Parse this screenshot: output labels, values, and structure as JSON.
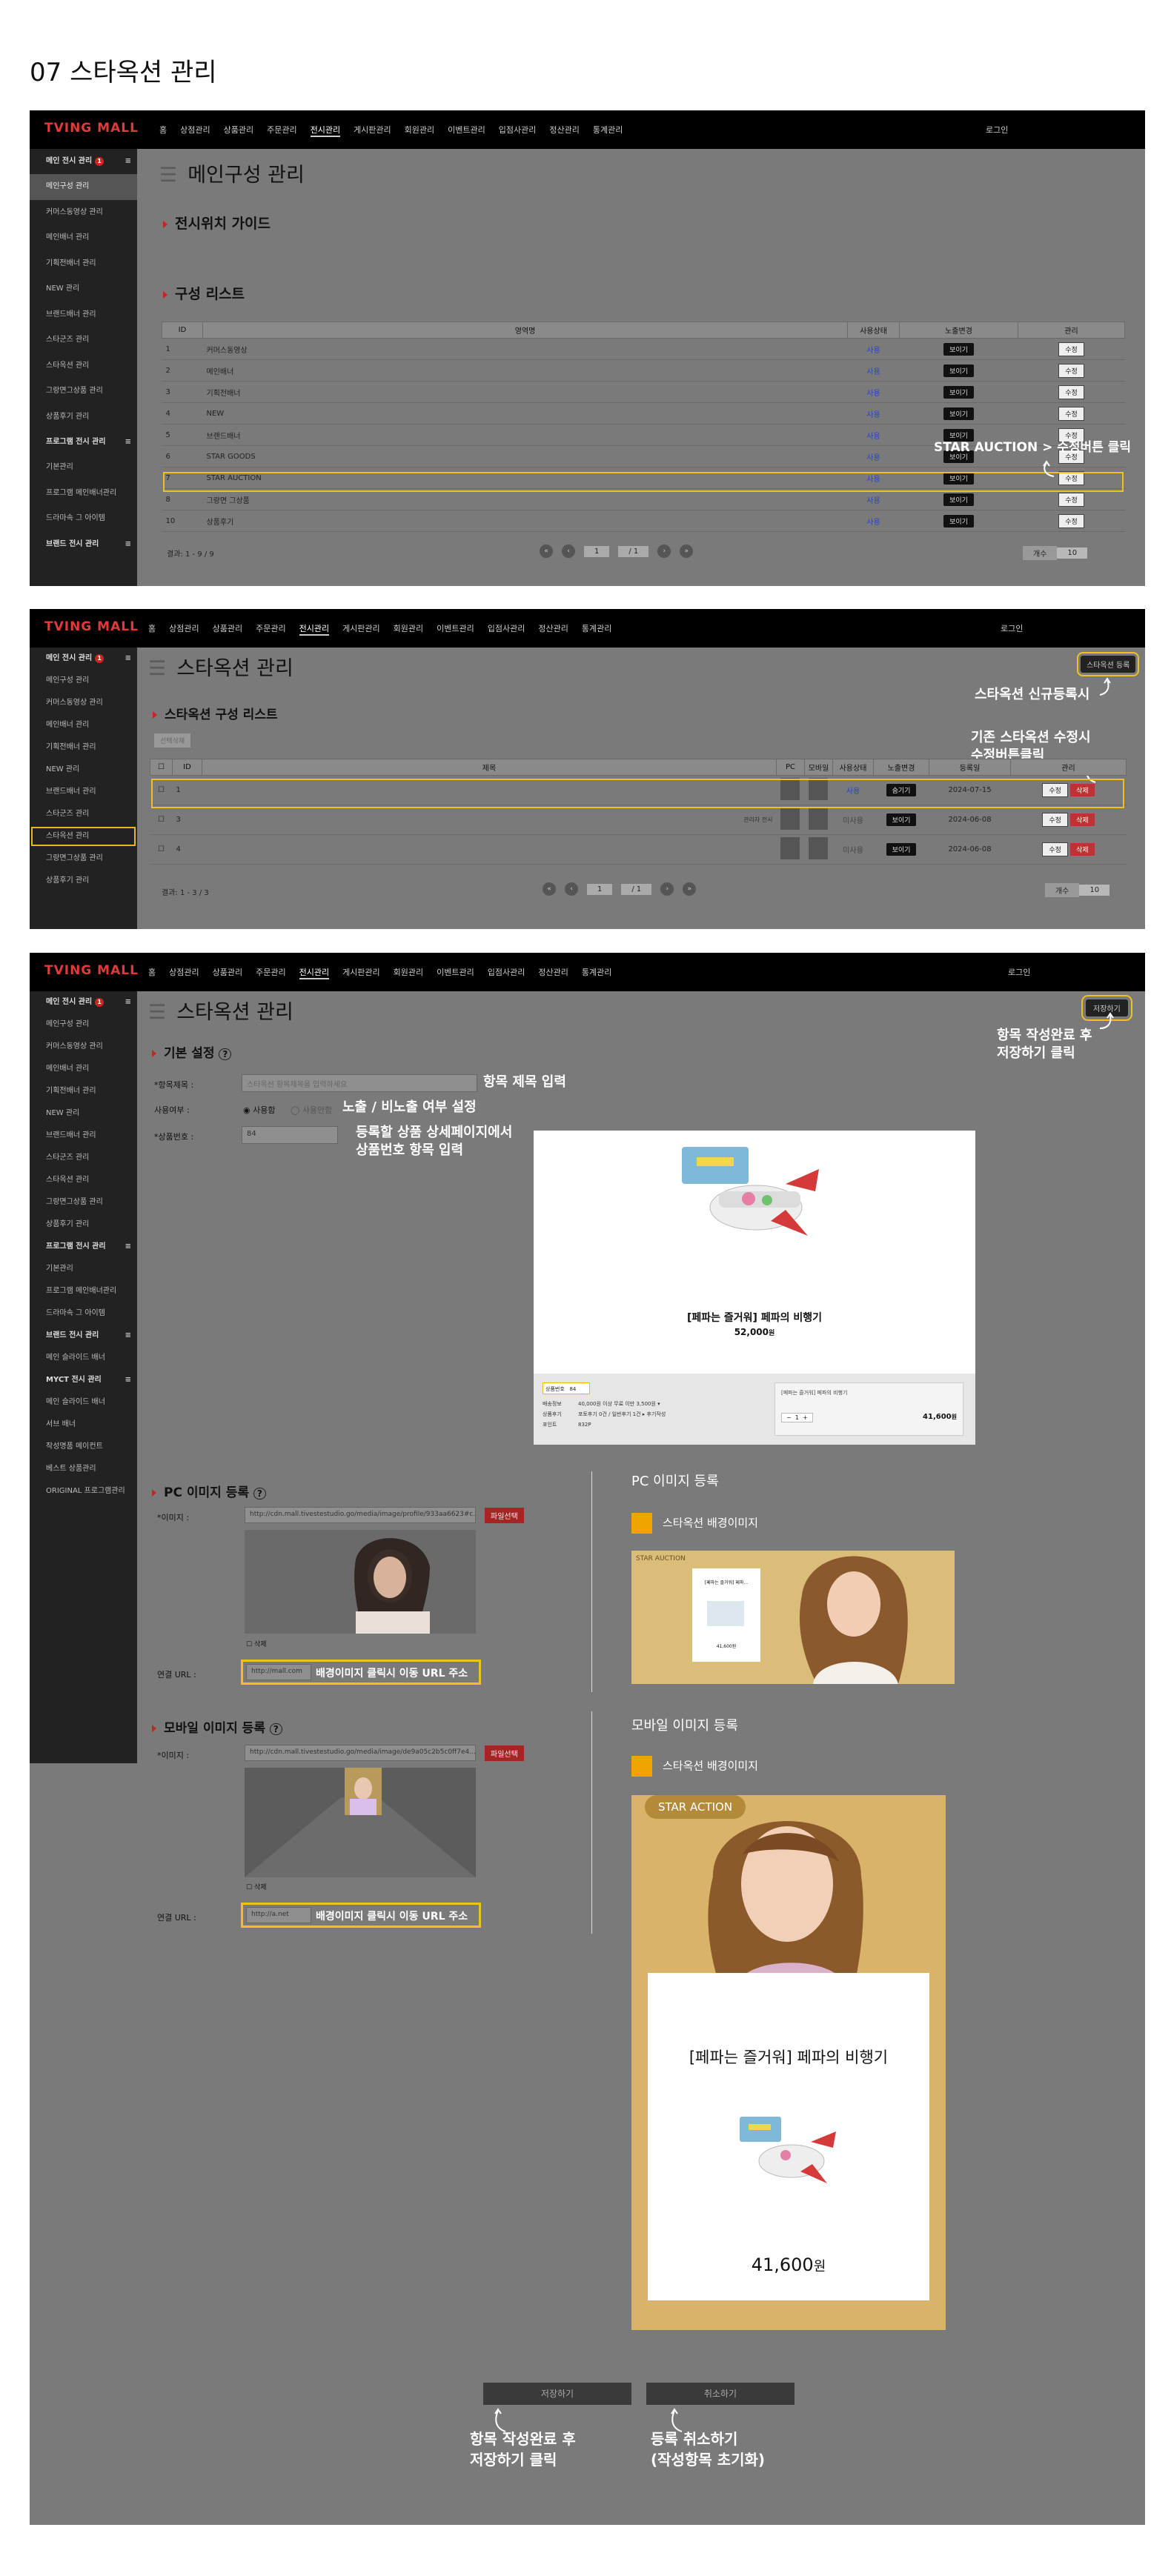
{
  "page_title": "07 스타옥션 관리",
  "colors": {
    "accent_yellow": "#f0c020",
    "red": "#c22222",
    "brand_red": "#e03a3a",
    "orange": "#f0a400"
  },
  "brand": "TVING MALL",
  "nav1": [
    "홈",
    "상점관리",
    "상품관리",
    "주문관리",
    "전시관리",
    "게시판관리",
    "회원관리",
    "이벤트관리",
    "입점사관리",
    "정산관리",
    "통계관리"
  ],
  "nav2": [
    "홈",
    "상점관리",
    "상품관리",
    "주문관리",
    "전시관리",
    "게시판관리",
    "회원관리",
    "이벤트관리",
    "입점사관리",
    "정산관리",
    "통계관리"
  ],
  "nav3": [
    "홈",
    "상점관리",
    "상품관리",
    "주문관리",
    "전시관리",
    "게시판관리",
    "회원관리",
    "이벤트관리",
    "입점사관리",
    "정산관리",
    "통계관리"
  ],
  "login": "로그인",
  "sidebar1": {
    "head": "메인 전시 관리",
    "badge": "1",
    "items": [
      "메인구성 관리",
      "커머스동영상 관리",
      "메인배너 관리",
      "기획전배너 관리",
      "NEW 관리",
      "브랜드배너 관리",
      "스타군즈 관리",
      "스타옥션 관리",
      "그랑면그상품 관리",
      "상품후기 관리"
    ],
    "head2": "프로그램 전시 관리",
    "items2": [
      "기본관리",
      "프로그램 메인배너관리",
      "드라마속 그 아이템"
    ],
    "head3": "브랜드 전시 관리"
  },
  "sidebar2": {
    "head": "메인 전시 관리",
    "badge": "1",
    "items": [
      "메인구성 관리",
      "커머스동영상 관리",
      "메인배너 관리",
      "기획전배너 관리",
      "NEW 관리",
      "브랜드배너 관리",
      "스타군즈 관리",
      "스타옥션 관리",
      "그랑면그상품 관리",
      "상품후기 관리"
    ]
  },
  "sidebar3": {
    "head": "메인 전시 관리",
    "badge": "1",
    "items": [
      "메인구성 관리",
      "커머스동영상 관리",
      "메인배너 관리",
      "기획전배너 관리",
      "NEW 관리",
      "브랜드배너 관리",
      "스타군즈 관리",
      "스타옥션 관리",
      "그랑면그상품 관리",
      "상품후기 관리"
    ],
    "head2": "프로그램 전시 관리",
    "items2": [
      "기본관리",
      "프로그램 메인배너관리",
      "드라마속 그 아이템"
    ],
    "head3": "브랜드 전시 관리",
    "items3": [
      "메인 슬라이드 배너"
    ],
    "head4": "MYCT 전시 관리",
    "items4": [
      "메인 슬라이드 배너",
      "서브 배너",
      "작성명품 메이컨트",
      "베스트 상품관리",
      "ORIGINAL 프로그램관리"
    ]
  },
  "s1": {
    "title": "메인구성 관리",
    "guide": "전시위치 가이드",
    "list_title": "구성 리스트",
    "headers": [
      "ID",
      "영역명",
      "사용상태",
      "노출변경",
      "관리"
    ],
    "rows": [
      {
        "id": "1",
        "name": "커머스동영상",
        "use": "사용",
        "show": "보이기",
        "act": "수정"
      },
      {
        "id": "2",
        "name": "메인배너",
        "use": "사용",
        "show": "보이기",
        "act": "수정"
      },
      {
        "id": "3",
        "name": "기획전배너",
        "use": "사용",
        "show": "보이기",
        "act": "수정"
      },
      {
        "id": "4",
        "name": "NEW",
        "use": "사용",
        "show": "보이기",
        "act": "수정"
      },
      {
        "id": "5",
        "name": "브랜드배너",
        "use": "사용",
        "show": "보이기",
        "act": "수정"
      },
      {
        "id": "6",
        "name": "STAR GOODS",
        "use": "사용",
        "show": "보이기",
        "act": "수정"
      },
      {
        "id": "7",
        "name": "STAR AUCTION",
        "use": "사용",
        "show": "보이기",
        "act": "수정"
      },
      {
        "id": "8",
        "name": "그랑면 그상품",
        "use": "사용",
        "show": "보이기",
        "act": "수정"
      },
      {
        "id": "10",
        "name": "상품후기",
        "use": "사용",
        "show": "보이기",
        "act": "수정"
      }
    ],
    "result": "결과: 1 - 9 / 9",
    "page": "1",
    "page_total": "/ 1",
    "per_label": "개수",
    "per_value": "10",
    "annotation": "STAR AUCTION > 수정버튼 클릭"
  },
  "s2": {
    "title": "스타옥션 관리",
    "register_btn": "스타옥션 등록",
    "list_title": "스타옥션 구성 리스트",
    "delete_sel": "선택삭제",
    "headers": [
      "ID",
      "제목",
      "PC",
      "모바일",
      "사용상태",
      "노출변경",
      "등록일",
      "관리"
    ],
    "rows": [
      {
        "id": "1",
        "use": "사용",
        "show": "숨기기",
        "date": "2024-07-15",
        "edit": "수정",
        "del": "삭제"
      },
      {
        "id": "3",
        "use": "미사용",
        "show": "보이기",
        "date": "2024-06-08",
        "edit": "수정",
        "del": "삭제"
      },
      {
        "id": "4",
        "use": "미사용",
        "show": "보이기",
        "date": "2024-06-08",
        "edit": "수정",
        "del": "삭제"
      }
    ],
    "row3_tag": "관리자 전시",
    "result": "결과: 1 - 3 / 3",
    "page": "1",
    "page_total": "/ 1",
    "per_label": "개수",
    "per_value": "10",
    "ann_new": "스타옥션 신규등록시",
    "ann_edit": "기존 스타옥션 수정시\n수정버튼클릭"
  },
  "s3": {
    "title": "스타옥션 관리",
    "save_top": "저장하기",
    "ann_save_top": "항목 작성완료 후\n저장하기 클릭",
    "basic": "기본 설정",
    "f_title_label": "*항목제목 :",
    "f_title_ph": "스타옥션 항목제목을 입력하세요",
    "f_use_label": "사용여부 :",
    "f_use_on": "사용함",
    "f_use_off": "사용안함",
    "f_pno_label": "*상품번호 :",
    "f_pno_value": "84",
    "ann_title": "항목 제목 입력",
    "ann_use": "노출 / 비노출 여부 설정",
    "ann_pno": "등록할 상품 상세페이지에서\n상품번호 항목 입력",
    "prod_name": "[페파는 즐거워] 페파의 비행기",
    "prod_price": "52,000",
    "prod_price_unit": "원",
    "prod_box_label": "상품번호",
    "prod_box_value": "84",
    "prod_rows": [
      {
        "k": "배송정보",
        "v": "40,000원 이상 무료 이만 3,500원 ▾"
      },
      {
        "k": "상품후기",
        "v": "포토후기 0건 / 일반후기 1건 ▸ 후기작성"
      },
      {
        "k": "포인트",
        "v": "832P"
      }
    ],
    "opt_name": "[페파는 즐거워] 페파의 비행기",
    "opt_qty": "1",
    "opt_price": "41,600",
    "opt_unit": "원",
    "pc_title": "PC 이미지 등록",
    "pc_img_label": "*이미지 :",
    "pc_img_value": "http://cdn.mall.tivestestudio.go/media/image/profile/933aa6623#c...",
    "file_btn": "파일선택",
    "delete_chk": "삭제",
    "pc_url_label": "연결 URL :",
    "pc_url_value": "http://mall.com",
    "ann_url": "배경이미지 클릭시 이동 URL 주소",
    "pc_preview_title": "PC 이미지 등록",
    "pc_preview_bg": "스타옥션 배경이미지",
    "pc_preview_tag": "STAR AUCTION",
    "pc_mini_title": "[페파는 즐거워] 페파...",
    "pc_mini_price": "41,600원",
    "m_title": "모바일 이미지 등록",
    "m_img_label": "*이미지 :",
    "m_img_value": "http://cdn.mall.tivestestudio.go/media/image/de9a05c2b5c0ff7e4...",
    "m_url_label": "연결 URL :",
    "m_url_value": "http://a.net",
    "m_preview_title": "모바일 이미지 등록",
    "m_preview_bg": "스타옥션 배경이미지",
    "m_preview_tag": "STAR ACTION",
    "m_card_title": "[페파는 즐거워] 페파의 비행기",
    "m_card_price": "41,600",
    "m_card_unit": "원",
    "save_btn": "저장하기",
    "cancel_btn": "취소하기",
    "ann_save": "항목 작성완료 후\n저장하기 클릭",
    "ann_cancel": "등록 취소하기\n(작성항목 초기화)"
  }
}
